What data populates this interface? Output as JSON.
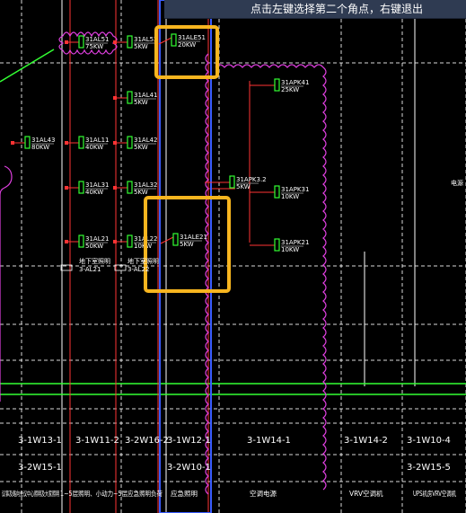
{
  "prompt": {
    "text": "点击左键选择第二个角点，右键退出"
  },
  "colors": {
    "background": "#000000",
    "grid_line": "#ffffff",
    "circuit_line": "#ff3333",
    "equipment_symbol": "#33ff33",
    "label_text": "#ffffff",
    "revision_cloud": "#e040e0",
    "highlight_box": "#f7b51f",
    "selection_column": "#3a5cff",
    "bus_line": "#33ff33"
  },
  "panels": [
    {
      "id": "1AL51",
      "label": "31AL51",
      "power": "75KW"
    },
    {
      "id": "1AL52",
      "label": "31AL52",
      "power": "5KW"
    },
    {
      "id": "1ALE51",
      "label": "31ALE51",
      "power": "20KW"
    },
    {
      "id": "1AL41",
      "label": "31AL41",
      "power": "5KW"
    },
    {
      "id": "1APK41",
      "label": "31APK41",
      "power": "25KW"
    },
    {
      "id": "1AL43",
      "label": "31AL43",
      "power": "80KW"
    },
    {
      "id": "1AL11",
      "label": "31AL11",
      "power": "40KW"
    },
    {
      "id": "1AL42",
      "label": "31AL42",
      "power": "5KW"
    },
    {
      "id": "1APK32",
      "label": "31APK3.2",
      "power": "5KW"
    },
    {
      "id": "1AL31",
      "label": "31AL31",
      "power": "40KW"
    },
    {
      "id": "1AL32",
      "label": "31AL32",
      "power": "5KW"
    },
    {
      "id": "1APK31",
      "label": "31APK31",
      "power": "10KW"
    },
    {
      "id": "1AL21",
      "label": "31AL21",
      "power": "50KW"
    },
    {
      "id": "1AL22",
      "label": "31AL22",
      "power": "10KW"
    },
    {
      "id": "1ALE21",
      "label": "31ALE21",
      "power": "5KW"
    },
    {
      "id": "1APK21",
      "label": "31APK21",
      "power": "10KW"
    }
  ],
  "small_notes": {
    "note_a": "3-AL21",
    "note_b": "3-AL22",
    "note_a_top": "地下室照明",
    "note_b_top": "地下室照明",
    "right_edge": "电源"
  },
  "circuit_row_1": [
    "3-1W13-1",
    "3-1W11-2",
    "3-2W16-2",
    "3-1W12-1",
    "3-1W14-1",
    "3-1W14-2",
    "3-1W10-4"
  ],
  "circuit_row_2": [
    "3-2W15-1",
    "3-2W10-1",
    "3-2W15-5"
  ],
  "descriptions": [
    "议事及路向会议中心照明及大家照明",
    "1~5层照明、小动力~5层应急照明负荷",
    "应急照明",
    "空调电源",
    "VRV空调机",
    "UPS机房VRV空调机"
  ]
}
